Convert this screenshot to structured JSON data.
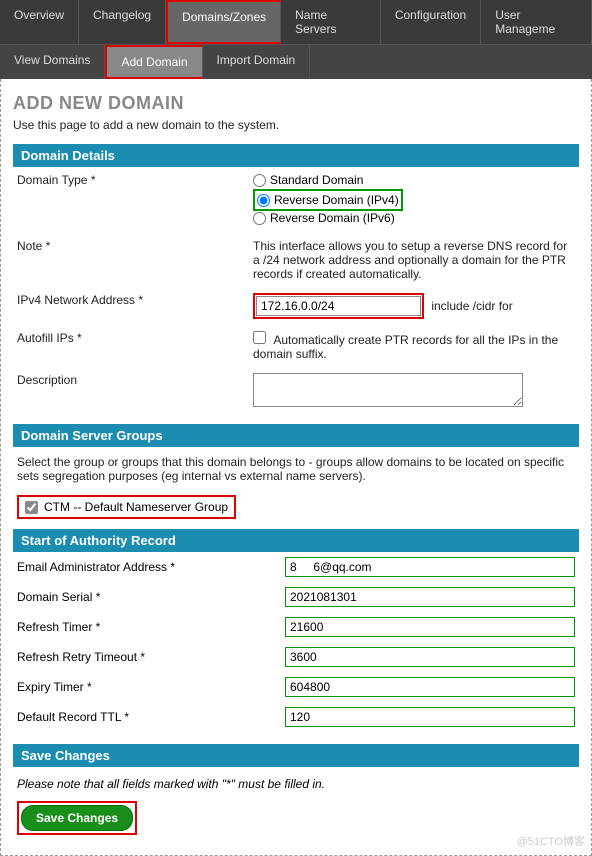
{
  "nav_primary": {
    "overview": "Overview",
    "changelog": "Changelog",
    "domains": "Domains/Zones",
    "nameservers": "Name Servers",
    "configuration": "Configuration",
    "usermanagement": "User Manageme"
  },
  "nav_secondary": {
    "view": "View Domains",
    "add": "Add Domain",
    "import": "Import Domain"
  },
  "page": {
    "title": "ADD NEW DOMAIN",
    "subtitle": "Use this page to add a new domain to the system."
  },
  "domain_details": {
    "heading": "Domain Details",
    "type_label": "Domain Type *",
    "type_option_standard": "Standard Domain",
    "type_option_rev4": "Reverse Domain (IPv4)",
    "type_option_rev6": "Reverse Domain (IPv6)",
    "note_label": "Note *",
    "note_text": "This interface allows you to setup a reverse DNS record for a /24 network address and optionally a domain for the PTR records if created automatically.",
    "ipv4_label": "IPv4 Network Address *",
    "ipv4_value": "172.16.0.0/24",
    "ipv4_hint": "include /cidr for",
    "autofill_label": "Autofill IPs *",
    "autofill_checkbox": "Automatically create PTR records for all the IPs in the domain suffix.",
    "description_label": "Description"
  },
  "server_groups": {
    "heading": "Domain Server Groups",
    "help": "Select the group or groups that this domain belongs to - groups allow domains to be located on specific sets segregation purposes (eg internal vs external name servers).",
    "group1": "CTM -- Default Nameserver Group"
  },
  "soa": {
    "heading": "Start of Authority Record",
    "email_label": "Email Administrator Address *",
    "email_value": "8     6@qq.com",
    "serial_label": "Domain Serial *",
    "serial_value": "2021081301",
    "refresh_label": "Refresh Timer *",
    "refresh_value": "21600",
    "retry_label": "Refresh Retry Timeout *",
    "retry_value": "3600",
    "expiry_label": "Expiry Timer *",
    "expiry_value": "604800",
    "ttl_label": "Default Record TTL *",
    "ttl_value": "120"
  },
  "save": {
    "heading": "Save Changes",
    "note": "Please note that all fields marked with \"*\" must be filled in.",
    "button": "Save Changes"
  },
  "watermark": "@51CTO博客"
}
